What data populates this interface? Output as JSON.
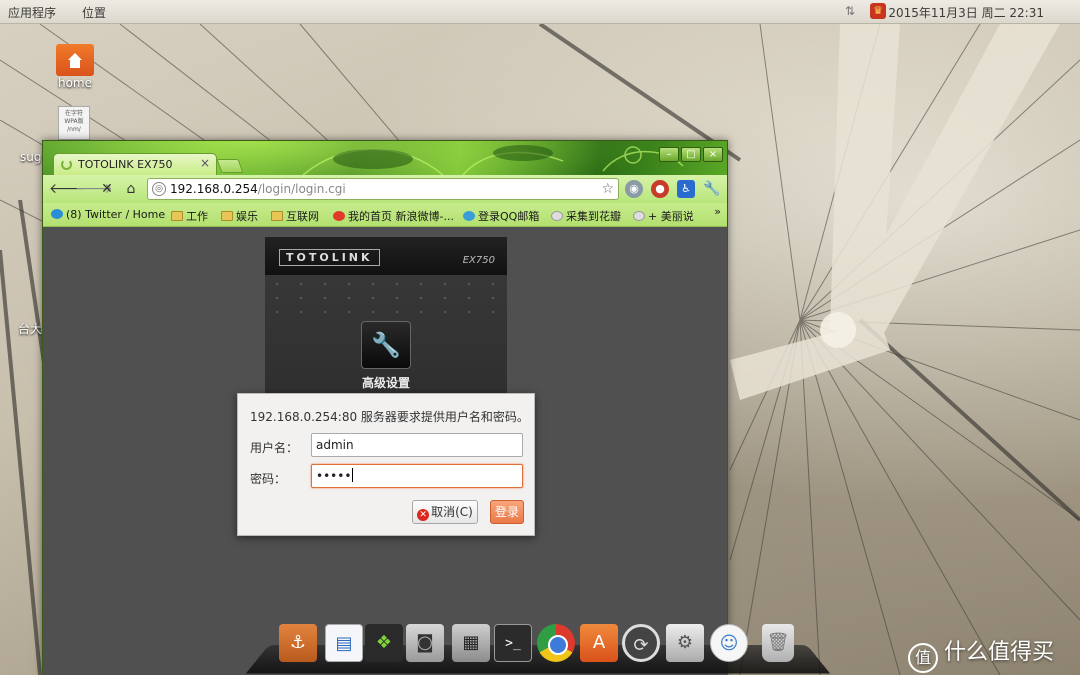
{
  "top_panel": {
    "apps_menu": "应用程序",
    "places_menu": "位置",
    "clock": "2015年11月3日 周二 22:31",
    "tray_red_glyph": "♛"
  },
  "desktop": {
    "home_label": "home",
    "doc_text": "在字符\nWPA版\n/nm/",
    "side_text_1": "sug",
    "side_text_2": "台大"
  },
  "browser": {
    "tab_title": "TOTOLINK EX750",
    "tab_close": "×",
    "url_host": "192.168.0.254",
    "url_path": "/login/login.cgi",
    "window_buttons": {
      "min": "–",
      "max": "□",
      "close": "×"
    },
    "bookmarks": [
      {
        "label": "(8) Twitter / Home",
        "icon": "twitter-icon"
      },
      {
        "label": "工作",
        "icon": "folder-icon"
      },
      {
        "label": "娱乐",
        "icon": "folder-icon"
      },
      {
        "label": "互联网",
        "icon": "folder-icon"
      },
      {
        "label": "我的首页 新浪微博-...",
        "icon": "weibo-icon"
      },
      {
        "label": "登录QQ邮箱",
        "icon": "qq-mail-icon"
      },
      {
        "label": "采集到花瓣",
        "icon": "huaban-icon"
      },
      {
        "label": "+ 美丽说",
        "icon": "meilishuo-icon"
      }
    ],
    "bookmarks_more": "»"
  },
  "page": {
    "logo_text": "TOTOLINK",
    "model": "EX750",
    "advanced_label": "高级设置"
  },
  "auth_dialog": {
    "message": "192.168.0.254:80 服务器要求提供用户名和密码。",
    "username_label": "用户名：",
    "username_value": "admin",
    "password_label": "密码：",
    "password_mask": "•••••",
    "cancel_label": "取消(C)",
    "login_label": "登录"
  },
  "dock": {
    "items": [
      "anchor-icon",
      "document-viewer-icon",
      "cube-icon",
      "camera-icon",
      "calculator-icon",
      "terminal-icon",
      "chrome-icon",
      "software-center-icon",
      "update-icon",
      "system-settings-icon",
      "chat-icon",
      "trash-icon"
    ],
    "terminal_glyph": ">_"
  },
  "watermark": {
    "badge": "值",
    "text": "什么值得买"
  }
}
